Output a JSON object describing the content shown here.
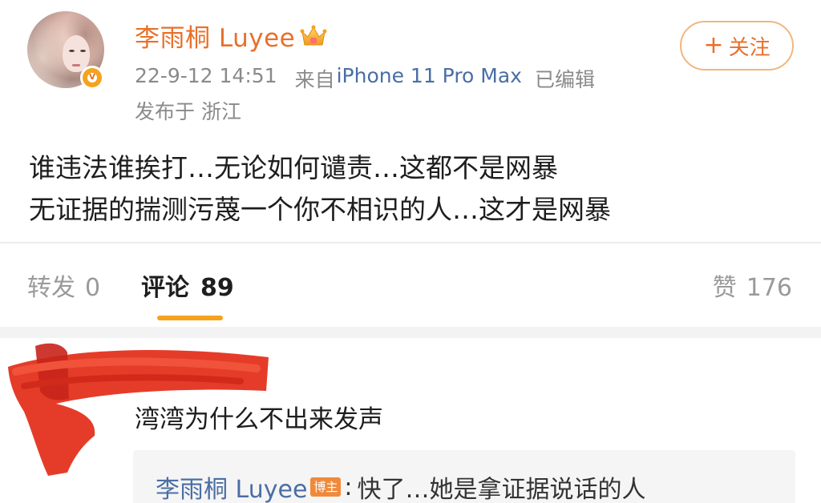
{
  "post": {
    "author": "李雨桐 Luyee",
    "crown_icon": "crown-icon",
    "verified_icon": "verified-v-icon",
    "time": "22-9-12 14:51",
    "from_label": "来自",
    "device": "iPhone 11 Pro Max",
    "edited": "已编辑",
    "location": "发布于 浙江",
    "follow_plus": "+",
    "follow_label": "关注",
    "body_lines": [
      "谁违法谁挨打…无论如何谴责…这都不是网暴",
      "无证据的揣测污蔑一个你不相识的人…这才是网暴"
    ]
  },
  "tabs": {
    "repost_label": "转发",
    "repost_count": "0",
    "comments_label": "评论",
    "comments_count": "89",
    "likes_label": "赞",
    "likes_count": "176",
    "active": "comments"
  },
  "comment": {
    "text": "湾湾为什么不出来发声",
    "reply": {
      "author": "李雨桐 Luyee",
      "badge": "博主",
      "colon": ":",
      "text": "快了…她是拿证据说话的人"
    }
  },
  "colors": {
    "brand_orange": "#e8702a",
    "link_blue": "#4a6ea4",
    "accent_yellow": "#f6a21e",
    "redaction_red": "#e4321d"
  }
}
